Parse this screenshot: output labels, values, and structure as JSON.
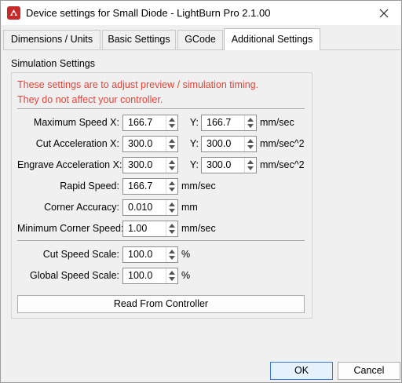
{
  "window": {
    "title": "Device settings for Small Diode - LightBurn Pro 2.1.00",
    "close_glyph": "✕"
  },
  "tabs": [
    {
      "label": "Dimensions / Units"
    },
    {
      "label": "Basic Settings"
    },
    {
      "label": "GCode"
    },
    {
      "label": "Additional Settings",
      "active": true
    }
  ],
  "group": {
    "title": "Simulation Settings",
    "warning_line1": "These settings are to adjust preview / simulation timing.",
    "warning_line2": "They do not affect your controller.",
    "warning_color": "#e0443a"
  },
  "rows": {
    "max_speed": {
      "label": "Maximum Speed X:",
      "x_value": "166.7",
      "y_label": "Y:",
      "y_value": "166.7",
      "unit": "mm/sec"
    },
    "cut_accel": {
      "label": "Cut Acceleration X:",
      "x_value": "300.0",
      "y_label": "Y:",
      "y_value": "300.0",
      "unit": "mm/sec^2"
    },
    "engrave_accel": {
      "label": "Engrave Acceleration X:",
      "x_value": "300.0",
      "y_label": "Y:",
      "y_value": "300.0",
      "unit": "mm/sec^2"
    },
    "rapid_speed": {
      "label": "Rapid Speed:",
      "value": "166.7",
      "unit": "mm/sec"
    },
    "corner_accuracy": {
      "label": "Corner Accuracy:",
      "value": "0.010",
      "unit": "mm"
    },
    "min_corner_speed": {
      "label": "Minimum Corner Speed:",
      "value": "1.00",
      "unit": "mm/sec"
    },
    "cut_speed_scale": {
      "label": "Cut Speed Scale:",
      "value": "100.0",
      "unit": "%"
    },
    "global_speed_scale": {
      "label": "Global Speed Scale:",
      "value": "100.0",
      "unit": "%"
    }
  },
  "buttons": {
    "read_from_controller": "Read From Controller",
    "ok": "OK",
    "cancel": "Cancel"
  }
}
